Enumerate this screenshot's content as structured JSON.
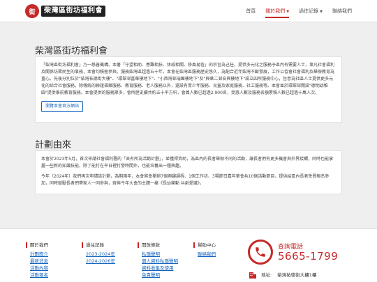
{
  "header": {
    "logo_text": "柴灣區街坊福利會",
    "nav": [
      {
        "label": "首頁",
        "has_dropdown": false,
        "active": false
      },
      {
        "label": "關於我們",
        "has_dropdown": true,
        "active": true
      },
      {
        "label": "過往記錄",
        "has_dropdown": true,
        "active": false
      },
      {
        "label": "聯絡我們",
        "has_dropdown": false,
        "active": false
      }
    ]
  },
  "about": {
    "title": "柴灣區街坊福利會",
    "body": "「柴灣區街坊福利會」乃一慈善機構。本著「守望相助、患難相扶、休戚相關、移風易俗」的宗旨為己任，提供多元化之服務予區內有需要人士，事凡社會福利及關係坊眾民生的事務，本會均積極參與。服務柴灣區超過五十年，本會在柴灣區服務歷史悠久，為配合近年柴灣不斷發展，工作以協會社會福利及舉辦教育為重心。先後分別位於\"柴灣祐德街大樓\"、\"環翠邨富華樓地下\"、\"小西灣邨瑞團樓地下\"及\"興華二邨安興樓地下\"設立四所服務中心，旨意為社區人士提供更多元化的綜合社會服務，除傳統的聯誼福樂服務、教育服務、老人服務以外，還設有青少年服務、兒童及家庭服務、社工服務等。本會並於環翠邨開設\"德明幼稚園\"提供學前教育服務。本會提供的服務眾多，會所歷史續共約五十平方呎，會員人數已超過2,900名，受惠人數及服務名額累積人數已超過十萬人次。",
    "button_label": "瀏覽本會官方網站"
  },
  "plan": {
    "title": "計劃由來",
    "para1": "本會於2023年5月，首次申請社會福利署的「丟有所為活動計劃」，並獲得資助，為區內的長者舉辦不同的活動，讓長者們有更多機會與外界接觸，同時也能掌握一些新的知識技能，除了能打在平日裡打發時間外，也能培養出一種興趣。",
    "para2": "今年（2024年）我們再次申請該計劃，為期兩年，本會將會舉辦7個興趣課程、1個工作坊、3場節日嘉年華會共10個活動節目，提供給區內長者免費報名參加，同時鼓勵長者們帶家人一同參與，齊與今年大會的主題一樣《長幼樂動 共創愛識》。"
  },
  "footer": {
    "columns": [
      {
        "heading": "關於我們",
        "links": [
          "計劃簡介",
          "最新消息",
          "活動內容",
          "活動報名"
        ]
      },
      {
        "heading": "過往記錄",
        "links": [
          "2023-2024年",
          "2024-2026年"
        ]
      },
      {
        "heading": "開放條款",
        "links": [
          "私隱聲明",
          "個人資料私隱聲明",
          "資料收集及使用",
          "免責聲明"
        ]
      },
      {
        "heading": "幫助中心",
        "links": [
          "聯絡我們"
        ]
      }
    ],
    "phone_label": "查詢電話",
    "phone_number": "5665-1799",
    "address_prefix": "地址:",
    "address": "柴灣祐德街大樓1樓"
  },
  "colors": {
    "accent": "#c62828",
    "link": "#1565c0",
    "background": "#efefef"
  },
  "icons": [
    "phone-icon",
    "building-icon",
    "caret-down-icon"
  ]
}
